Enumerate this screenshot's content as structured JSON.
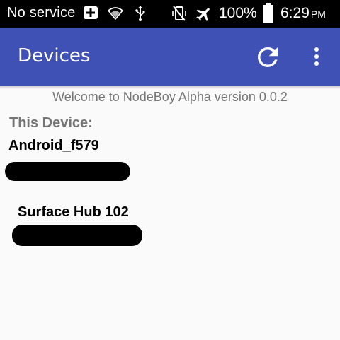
{
  "status_bar": {
    "carrier": "No service",
    "battery_percent": "100%",
    "time": "6:29",
    "ampm": "PM",
    "icons": [
      "notification-plus-icon",
      "wifi-icon",
      "usb-icon",
      "vibrate-off-icon",
      "airplane-mode-icon",
      "battery-icon"
    ]
  },
  "app_bar": {
    "title": "Devices",
    "refresh_icon": "refresh-icon",
    "overflow_icon": "more-vert-icon",
    "color": "#3f51b5"
  },
  "content": {
    "welcome": "Welcome to NodeBoy Alpha version 0.0.2",
    "this_device_label": "This Device:",
    "this_device_name": "Android_f579",
    "devices": [
      {
        "name": "Surface Hub 102"
      }
    ]
  }
}
